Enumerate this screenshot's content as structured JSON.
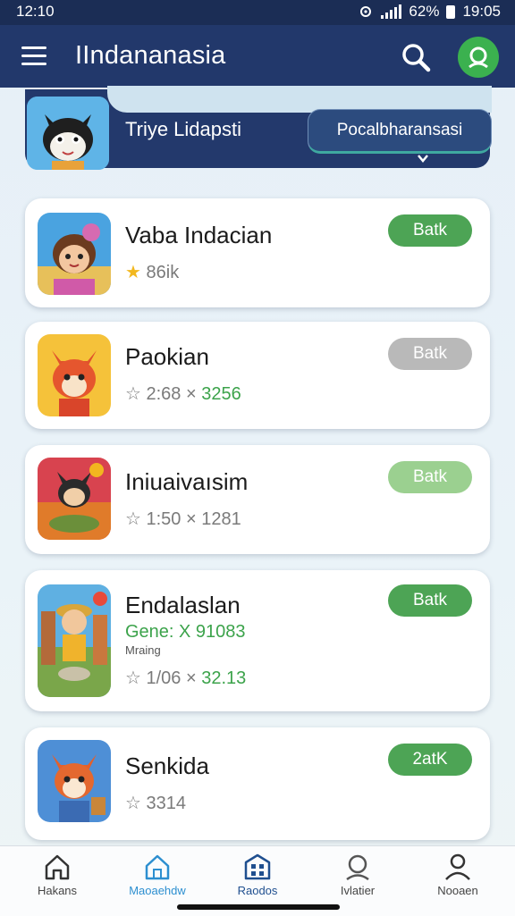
{
  "status_bar": {
    "time": "12:10",
    "battery": "62%",
    "clock": "19:05"
  },
  "app_bar": {
    "title": "IIndananasia",
    "menu_icon": "hamburger-menu-icon",
    "search_icon": "search-icon",
    "profile_icon": "profile-icon"
  },
  "banner": {
    "text": "Triye Lidapsti",
    "button_label": "Pocalbharansasi"
  },
  "apps": [
    {
      "name": "Vaba Indacian",
      "meta_prefix": "★",
      "meta": "86ik",
      "action": "Batk",
      "action_color": "#4da455"
    },
    {
      "name": "Paokian",
      "meta": "☆ 2:68 × ",
      "meta_green": "3256",
      "action": "Batk",
      "action_color": "#b9b9b9"
    },
    {
      "name": "Iniuaivaısim",
      "meta": "☆ 1:50 × 1281",
      "action": "Batk",
      "action_color": "#9bd090"
    },
    {
      "name": "Endalaslan",
      "genre": "Gene: X 91083",
      "sub": "Mraing",
      "meta": "☆ 1/06 × ",
      "meta_green": "32.13",
      "action": "Batk",
      "action_color": "#4da455"
    },
    {
      "name": "Senkida",
      "meta": "☆ 3314",
      "action": "2atK",
      "action_color": "#4da455"
    }
  ],
  "bottom_nav": [
    {
      "label": "Hakans",
      "icon": "home-icon"
    },
    {
      "label": "Maoaehdw",
      "icon": "home-outline-icon"
    },
    {
      "label": "Raodos",
      "icon": "grid-icon"
    },
    {
      "label": "Ivlatier",
      "icon": "search-person-icon"
    },
    {
      "label": "Nooaen",
      "icon": "person-icon"
    }
  ]
}
